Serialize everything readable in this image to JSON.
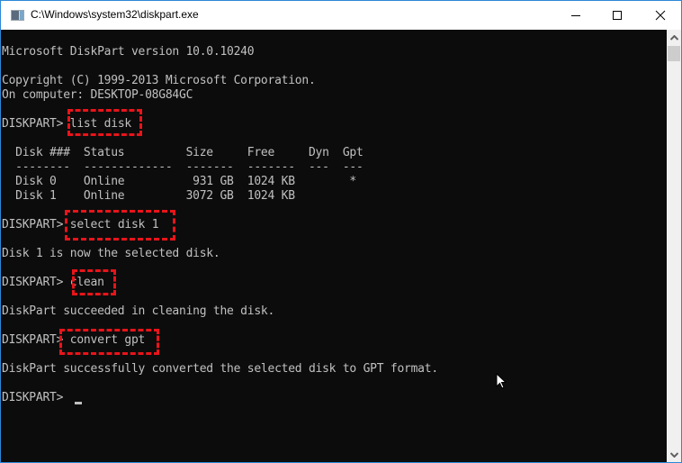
{
  "window": {
    "title": "C:\\Windows\\system32\\diskpart.exe",
    "icon": "console-app-icon",
    "controls": [
      "minimize-icon",
      "maximize-icon",
      "close-icon"
    ],
    "accent_color": "#2b88d8"
  },
  "console": {
    "background": "#0c0c0c",
    "text_color": "#c0c0c0",
    "highlight_color": "#e8141a",
    "lines": {
      "version": "Microsoft DiskPart version 10.0.10240",
      "copyright": "Copyright (C) 1999-2013 Microsoft Corporation.",
      "computer": "On computer: DESKTOP-08G84GC",
      "prompt1": "DISKPART> ",
      "cmd1": "list disk",
      "table_header": "  Disk ###  Status         Size     Free     Dyn  Gpt",
      "table_sep": "  --------  -------------  -------  -------  ---  ---",
      "table_row0": "  Disk 0    Online          931 GB  1024 KB        *",
      "table_row1": "  Disk 1    Online         3072 GB  1024 KB",
      "prompt2": "DISKPART> ",
      "cmd2": "select disk 1",
      "out2": "Disk 1 is now the selected disk.",
      "prompt3": "DISKPART> ",
      "cmd3": "clean",
      "out3": "DiskPart succeeded in cleaning the disk.",
      "prompt4": "DISKPART> ",
      "cmd4": "convert gpt",
      "out4": "DiskPart successfully converted the selected disk to GPT format.",
      "prompt5": "DISKPART> "
    },
    "disk_table": {
      "columns": [
        "Disk ###",
        "Status",
        "Size",
        "Free",
        "Dyn",
        "Gpt"
      ],
      "rows": [
        [
          "Disk 0",
          "Online",
          "931 GB",
          "1024 KB",
          "",
          "*"
        ],
        [
          "Disk 1",
          "Online",
          "3072 GB",
          "1024 KB",
          "",
          ""
        ]
      ]
    }
  }
}
